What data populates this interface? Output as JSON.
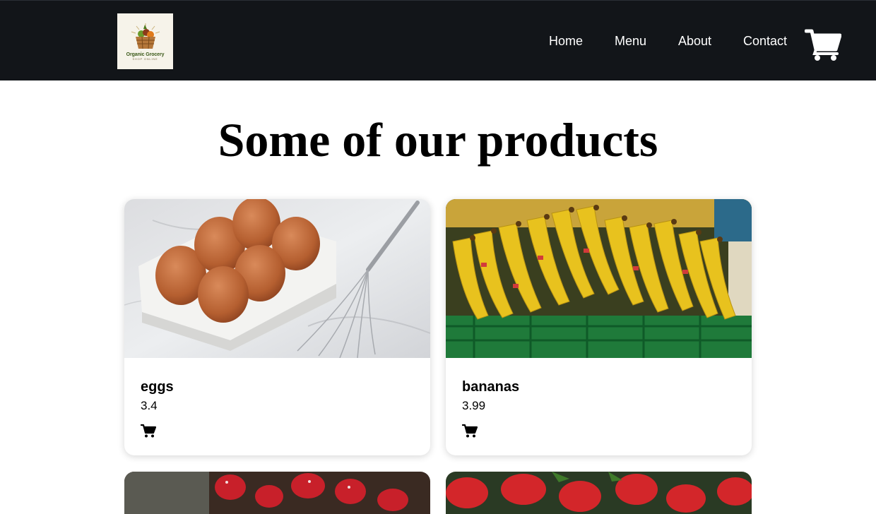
{
  "header": {
    "logo": {
      "title": "Organic Grocery",
      "subtitle": "SHOP ONLINE"
    },
    "nav": [
      {
        "label": "Home"
      },
      {
        "label": "Menu"
      },
      {
        "label": "About"
      },
      {
        "label": "Contact"
      }
    ],
    "cart_icon": "shopping-cart-icon"
  },
  "main": {
    "title": "Some of our products",
    "products": [
      {
        "name": "eggs",
        "price": "3.4",
        "image": "eggs-photo",
        "cart_icon": "shopping-cart-icon"
      },
      {
        "name": "bananas",
        "price": "3.99",
        "image": "bananas-photo",
        "cart_icon": "shopping-cart-icon"
      }
    ],
    "partial_products": [
      {
        "image": "strawberries-photo"
      },
      {
        "image": "strawberries-photo"
      }
    ]
  },
  "colors": {
    "navbar_bg": "#121519",
    "nav_text": "#ffffff",
    "page_bg": "#ffffff",
    "card_bg": "#ffffff"
  }
}
